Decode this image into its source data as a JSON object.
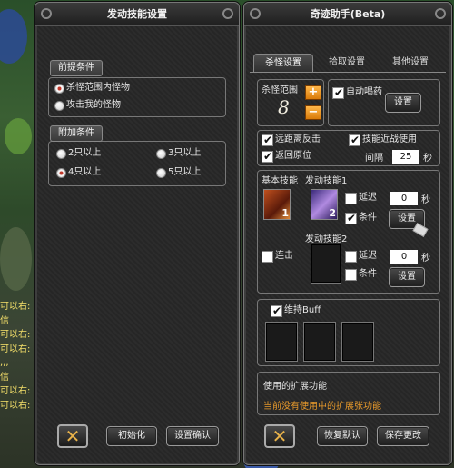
{
  "left_panel": {
    "title": "发动技能设置",
    "precondition": {
      "legend": "前提条件",
      "options": [
        "杀怪范围内怪物",
        "攻击我的怪物"
      ],
      "selected": 0
    },
    "extra_condition": {
      "legend": "附加条件",
      "options": [
        "2只以上",
        "3只以上",
        "4只以上",
        "5只以上"
      ],
      "selected": 2
    },
    "buttons": {
      "init": "初始化",
      "confirm": "设置确认"
    }
  },
  "right_panel": {
    "title": "奇迹助手(Beta)",
    "tabs": [
      "杀怪设置",
      "拾取设置",
      "其他设置"
    ],
    "active_tab": 0,
    "range": {
      "label": "杀怪范围",
      "value": "8"
    },
    "auto_potion": {
      "label": "自动喝药",
      "checked": true,
      "button": "设置"
    },
    "options": {
      "ranged_counter": {
        "label": "远距离反击",
        "checked": true
      },
      "skill_melee": {
        "label": "技能近战使用",
        "checked": true
      },
      "return_origin": {
        "label": "返回原位",
        "checked": true
      },
      "interval_label": "间隔",
      "interval_value": "25",
      "interval_unit": "秒"
    },
    "skills": {
      "basic_label": "基本技能",
      "basic_level": "1",
      "active1_label": "发动技能1",
      "active1_level": "2",
      "delay_label": "延迟",
      "delay1_checked": false,
      "delay1_value": "0",
      "delay_unit": "秒",
      "condition_label": "条件",
      "condition1_checked": true,
      "set1_button": "设置",
      "combo_label": "连击",
      "combo_checked": false,
      "active2_label": "发动技能2",
      "delay2_checked": false,
      "delay2_value": "0",
      "condition2_checked": false,
      "set2_button": "设置"
    },
    "buff": {
      "label": "维持Buff",
      "checked": true
    },
    "extension": {
      "title": "使用的扩展功能",
      "status": "当前没有使用中的扩展张功能"
    },
    "buttons": {
      "reset": "恢复默认",
      "save": "保存更改"
    }
  },
  "chat": [
    "可以右:",
    "信",
    "可以右:",
    "可以右:",
    ",,,",
    "信",
    "可以右:",
    "可以右:"
  ],
  "colors": {
    "accent": "#e89a2b",
    "radio_selected": "#c0392b"
  }
}
